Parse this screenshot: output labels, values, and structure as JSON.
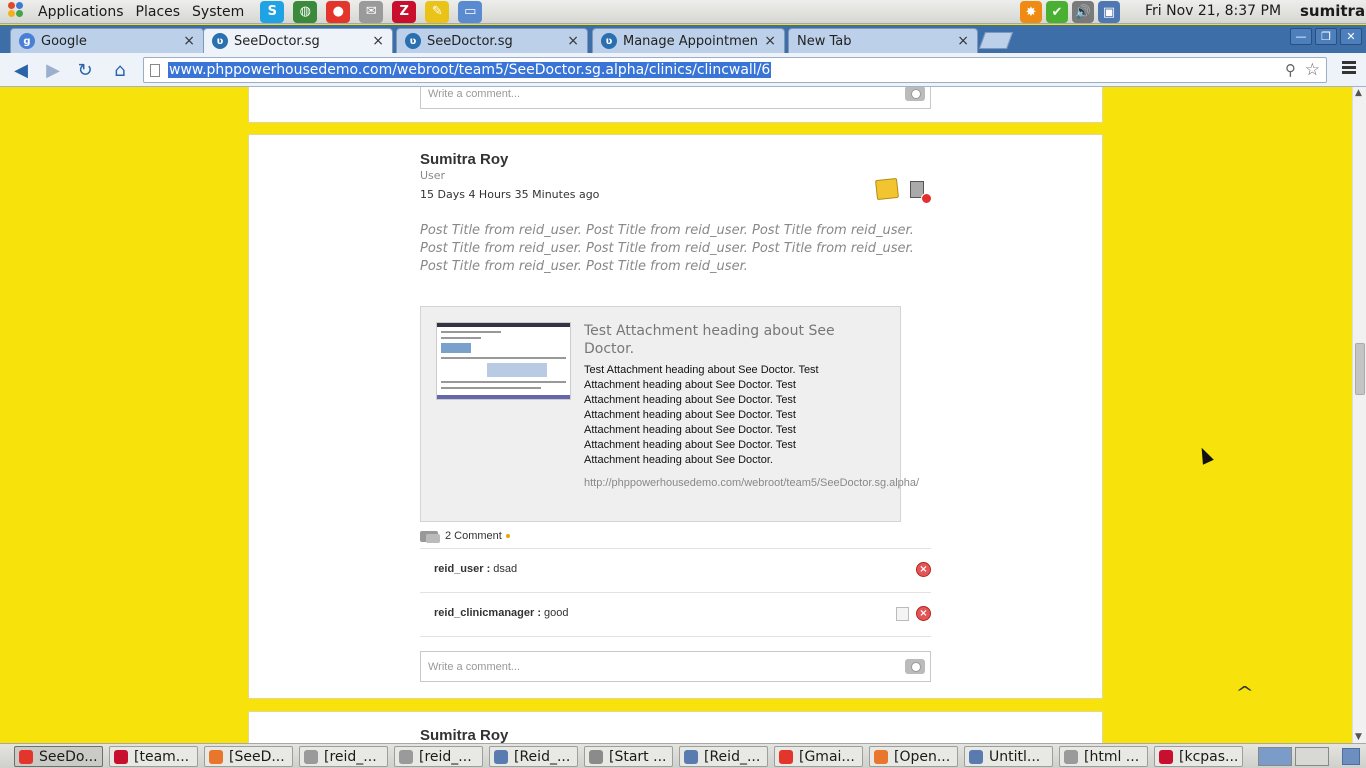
{
  "top_panel": {
    "menus": [
      "Applications",
      "Places",
      "System"
    ],
    "launchers": [
      {
        "icon": "skype-icon",
        "glyph": "S",
        "color": "#1fa3e5"
      },
      {
        "icon": "network-globe-icon",
        "glyph": "◍",
        "color": "#3b8a3b"
      },
      {
        "icon": "chrome-icon",
        "glyph": "●",
        "color": "#e3352b"
      },
      {
        "icon": "mail-client-icon",
        "glyph": "✉",
        "color": "#9a9a9a"
      },
      {
        "icon": "filezilla-icon",
        "glyph": "Z",
        "color": "#c8102e"
      },
      {
        "icon": "text-editor-icon",
        "glyph": "✎",
        "color": "#e9c318"
      },
      {
        "icon": "file-manager-icon",
        "glyph": "▭",
        "color": "#5a8ad0"
      }
    ],
    "tray": [
      {
        "icon": "update-notifier-icon",
        "glyph": "✸",
        "color": "#ef8a12"
      },
      {
        "icon": "status-ok-icon",
        "glyph": "✔",
        "color": "#49b032"
      },
      {
        "icon": "volume-icon",
        "glyph": "🔊",
        "color": "#7a7a7a"
      },
      {
        "icon": "network-connection-icon",
        "glyph": "▣",
        "color": "#4f78b2"
      }
    ],
    "clock": "Fri Nov 21,  8:37 PM",
    "username": "sumitra"
  },
  "browser": {
    "tabs": [
      {
        "title": "Google",
        "icon": "google-favicon",
        "glyph": "g",
        "color": "#4a7fd6",
        "active": false
      },
      {
        "title": "SeeDoctor.sg",
        "icon": "seedoctor-favicon",
        "glyph": "ʋ",
        "color": "#2a6fb0",
        "active": true
      },
      {
        "title": "SeeDoctor.sg",
        "icon": "seedoctor-favicon",
        "glyph": "ʋ",
        "color": "#2a6fb0",
        "active": false
      },
      {
        "title": "Manage Appointment",
        "icon": "seedoctor-favicon",
        "glyph": "ʋ",
        "color": "#2a6fb0",
        "active": false
      },
      {
        "title": "New Tab",
        "icon": "",
        "glyph": "",
        "color": "",
        "active": false
      }
    ],
    "tab_close": "×",
    "url": "www.phppowerhousedemo.com/webroot/team5/SeeDoctor.sg.alpha/clinics/clincwall/6"
  },
  "page": {
    "comment_placeholder": "Write a comment...",
    "post": {
      "author": "Sumitra Roy",
      "role": "User",
      "time": "15 Days 4 Hours 35 Minutes ago",
      "body": "Post Title from reid_user. Post Title from reid_user. Post Title from reid_user. Post Title from reid_user. Post Title from reid_user. Post Title from reid_user. Post Title from reid_user. Post Title from reid_user.",
      "attachment": {
        "title": "Test Attachment heading about See Doctor.",
        "description": "Test Attachment heading about See Doctor. Test Attachment heading about See Doctor. Test Attachment heading about See Doctor. Test Attachment heading about See Doctor. Test Attachment heading about See Doctor. Test Attachment heading about See Doctor. Test Attachment heading about See Doctor.",
        "url": "http://phppowerhousedemo.com/webroot/team5/SeeDoctor.sg.alpha/"
      },
      "comment_count": "2 Comment",
      "comments": [
        {
          "user": "reid_user :",
          "text": " dsad"
        },
        {
          "user": "reid_clinicmanager :",
          "text": " good"
        }
      ]
    },
    "next_post_author": "Sumitra Roy",
    "scroll_top_glyph": "^"
  },
  "taskbar": {
    "tasks": [
      {
        "label": "SeeDo...",
        "icon": "chrome-icon",
        "color": "#e3352b",
        "active": true
      },
      {
        "label": "[team...",
        "icon": "filezilla-icon",
        "color": "#c8102e",
        "active": false
      },
      {
        "label": "[SeeD...",
        "icon": "firefox-icon",
        "color": "#e8762d",
        "active": false
      },
      {
        "label": "[reid_...",
        "icon": "document-icon",
        "color": "#9a9a9a",
        "active": false
      },
      {
        "label": "[reid_...",
        "icon": "document-icon",
        "color": "#9a9a9a",
        "active": false
      },
      {
        "label": "[Reid_...",
        "icon": "text-file-icon",
        "color": "#5a7bb0",
        "active": false
      },
      {
        "label": "[Start ...",
        "icon": "application-icon",
        "color": "#8b8b8b",
        "active": false
      },
      {
        "label": "[Reid_...",
        "icon": "text-file-icon",
        "color": "#5a7bb0",
        "active": false
      },
      {
        "label": "[Gmai...",
        "icon": "chrome-icon",
        "color": "#e3352b",
        "active": false
      },
      {
        "label": "[Open...",
        "icon": "firefox-icon",
        "color": "#e8762d",
        "active": false
      },
      {
        "label": "Untitl...",
        "icon": "text-file-icon",
        "color": "#5a7bb0",
        "active": false
      },
      {
        "label": "[html ...",
        "icon": "document-icon",
        "color": "#9a9a9a",
        "active": false
      },
      {
        "label": "[kcpas...",
        "icon": "filezilla-icon",
        "color": "#c8102e",
        "active": false
      }
    ]
  }
}
